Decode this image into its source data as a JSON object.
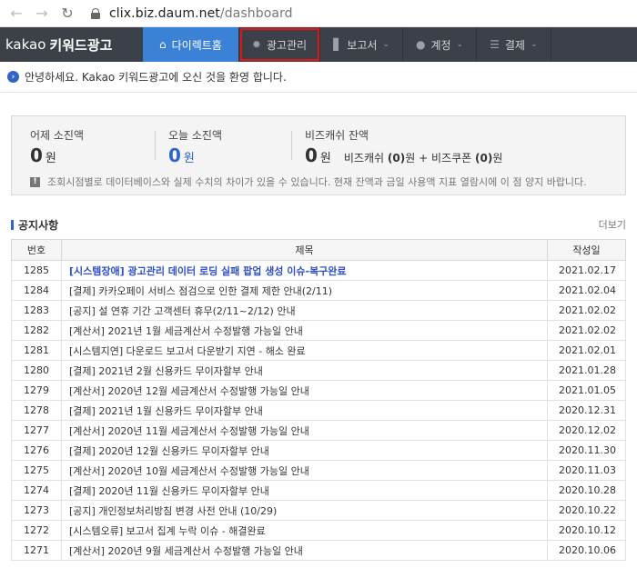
{
  "browser": {
    "url_host": "clix.biz.daum.net",
    "url_path": "/dashboard"
  },
  "brand": {
    "prefix": "kakao",
    "name": "키워드광고"
  },
  "menu": [
    {
      "label": "다이렉트홈",
      "icon": "home-icon",
      "caret": false
    },
    {
      "label": "광고관리",
      "icon": "gear-icon",
      "caret": false
    },
    {
      "label": "보고서",
      "icon": "bar-chart-icon",
      "caret": true
    },
    {
      "label": "계정",
      "icon": "user-icon",
      "caret": true
    },
    {
      "label": "결제",
      "icon": "database-icon",
      "caret": true
    }
  ],
  "welcome": "안녕하세요. Kakao 키워드광고에 오신 것을 환영 합니다.",
  "summary": {
    "yesterday_label": "어제 소진액",
    "yesterday_value": "0",
    "today_label": "오늘 소진액",
    "today_value": "0",
    "balance_label": "비즈캐쉬 잔액",
    "balance_value": "0",
    "unit": "원",
    "detail_cash": "비즈캐쉬",
    "detail_cash_value": "(0)",
    "detail_unit": "원",
    "detail_plus": "+",
    "detail_coupon": "비즈쿠폰",
    "detail_coupon_value": "(0)",
    "notice": "조회시점별로 데이터베이스와 실제 수치의 차이가 있을 수 있습니다. 현재 잔액과 금일 사용액 지표 열람시에 이 점 양지 바랍니다."
  },
  "notices": {
    "title": "공지사항",
    "more": "더보기",
    "columns": [
      "번호",
      "제목",
      "작성일"
    ],
    "rows": [
      {
        "no": "1285",
        "title": "[시스템장애] 광고관리 데이터 로딩 실패 팝업 생성 이슈-복구완료",
        "date": "2021.02.17",
        "emphasis": true
      },
      {
        "no": "1284",
        "title": "[결제] 카카오페이 서비스 점검으로 인한 결제 제한 안내(2/11)",
        "date": "2021.02.04",
        "emphasis": false
      },
      {
        "no": "1283",
        "title": "[공지] 설 연휴 기간 고객센터 휴무(2/11~2/12) 안내",
        "date": "2021.02.02",
        "emphasis": false
      },
      {
        "no": "1282",
        "title": "[계산서] 2021년 1월 세금계산서 수정발행 가능일 안내",
        "date": "2021.02.02",
        "emphasis": false
      },
      {
        "no": "1281",
        "title": "[시스템지연] 다운로드 보고서 다운받기 지연 - 해소 완료",
        "date": "2021.02.01",
        "emphasis": false
      },
      {
        "no": "1280",
        "title": "[결제] 2021년 2월 신용카드 무이자할부 안내",
        "date": "2021.01.28",
        "emphasis": false
      },
      {
        "no": "1279",
        "title": "[계산서] 2020년 12월 세금계산서 수정발행 가능일 안내",
        "date": "2021.01.05",
        "emphasis": false
      },
      {
        "no": "1278",
        "title": "[결제] 2021년 1월 신용카드 무이자할부 안내",
        "date": "2020.12.31",
        "emphasis": false
      },
      {
        "no": "1277",
        "title": "[계산서] 2020년 11월 세금계산서 수정발행 가능일 안내",
        "date": "2020.12.02",
        "emphasis": false
      },
      {
        "no": "1276",
        "title": "[결제] 2020년 12월 신용카드 무이자할부 안내",
        "date": "2020.11.30",
        "emphasis": false
      },
      {
        "no": "1275",
        "title": "[계산서] 2020년 10월 세금계산서 수정발행 가능일 안내",
        "date": "2020.11.03",
        "emphasis": false
      },
      {
        "no": "1274",
        "title": "[결제] 2020년 11월 신용카드 무이자할부 안내",
        "date": "2020.10.28",
        "emphasis": false
      },
      {
        "no": "1273",
        "title": "[공지] 개인정보처리방침 변경 사전 안내 (10/29)",
        "date": "2020.10.22",
        "emphasis": false
      },
      {
        "no": "1272",
        "title": "[시스템오류] 보고서 집계 누락 이슈 - 해결완료",
        "date": "2020.10.12",
        "emphasis": false
      },
      {
        "no": "1271",
        "title": "[계산서] 2020년 9월 세금계산서 수정발행 가능일 안내",
        "date": "2020.10.06",
        "emphasis": false
      }
    ]
  },
  "colors": {
    "nav_bg": "#3b4049",
    "active_tab": "#3b82d6",
    "highlight_outline": "#e01515",
    "accent_blue": "#2f64c8"
  }
}
